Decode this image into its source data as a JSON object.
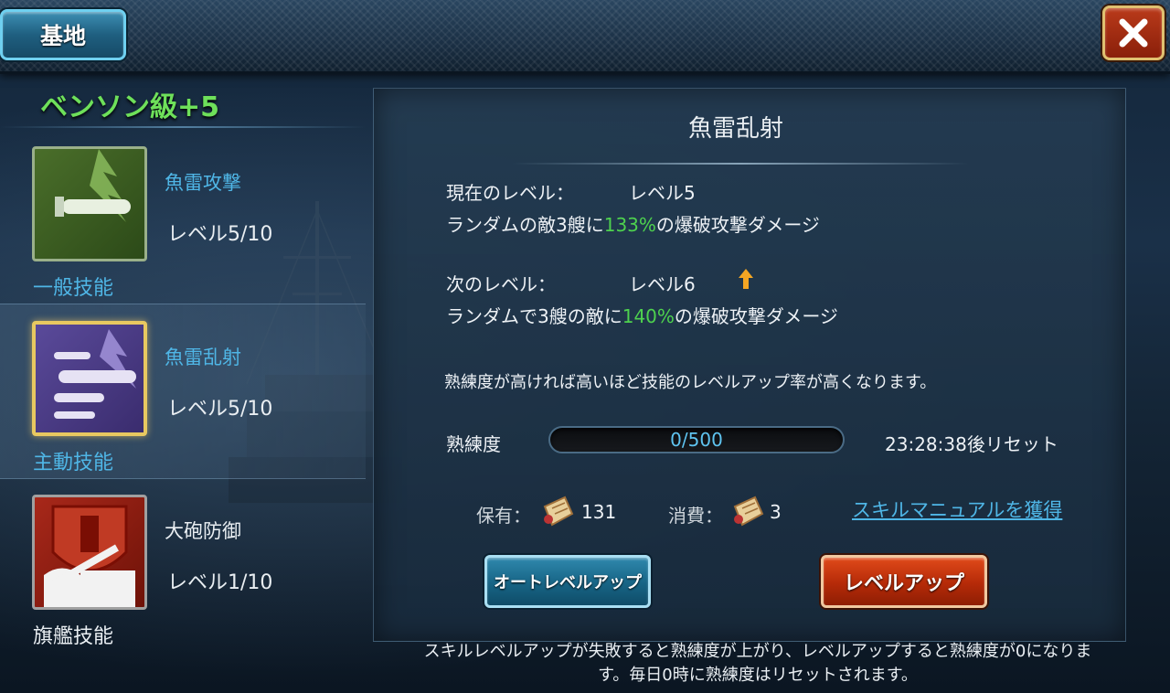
{
  "topbar": {
    "base_label": "基地"
  },
  "ship": {
    "name": "ベンソン級+5"
  },
  "skills": [
    {
      "name": "魚雷攻撃",
      "level": "レベル5/10",
      "category": "一般技能",
      "icon": "torpedo-icon"
    },
    {
      "name": "魚雷乱射",
      "level": "レベル5/10",
      "category": "主動技能",
      "icon": "torpedo-salvo-icon"
    },
    {
      "name": "大砲防御",
      "level": "レベル1/10",
      "category": "旗艦技能",
      "icon": "cannon-defense-icon"
    }
  ],
  "detail": {
    "title": "魚雷乱射",
    "current_label": "現在のレベル：",
    "current_level": "レベル5",
    "current_desc_pre": "ランダムの敵3艘に",
    "current_percent": "133%",
    "current_desc_post": "の爆破攻撃ダメージ",
    "next_label": "次のレベル：",
    "next_level": "レベル6",
    "next_desc_pre": "ランダムで3艘の敵に",
    "next_percent": "140%",
    "next_desc_post": "の爆破攻撃ダメージ",
    "hint": "熟練度が高ければ高いほど技能のレベルアップ率が高くなります。",
    "proficiency_label": "熟練度",
    "proficiency_text": "0/500",
    "proficiency_value": 0,
    "proficiency_max": 500,
    "reset_text": "23:28:38後リセット",
    "owned_label": "保有：",
    "owned_count": "131",
    "cost_label": "消費：",
    "cost_count": "3",
    "get_manual_link": "スキルマニュアルを獲得",
    "auto_button": "オートレベルアップ",
    "levelup_button": "レベルアップ"
  },
  "footer": {
    "note_line1": "スキルレベルアップが失敗すると熟練度が上がり、レベルアップすると熟練度が0になりま",
    "note_line2": "す。毎日0時に熟練度はリセットされます。"
  },
  "colors": {
    "accent_green": "#4ed24e",
    "link_blue": "#4fb6e6",
    "ship_name_green": "#6ee05a"
  }
}
